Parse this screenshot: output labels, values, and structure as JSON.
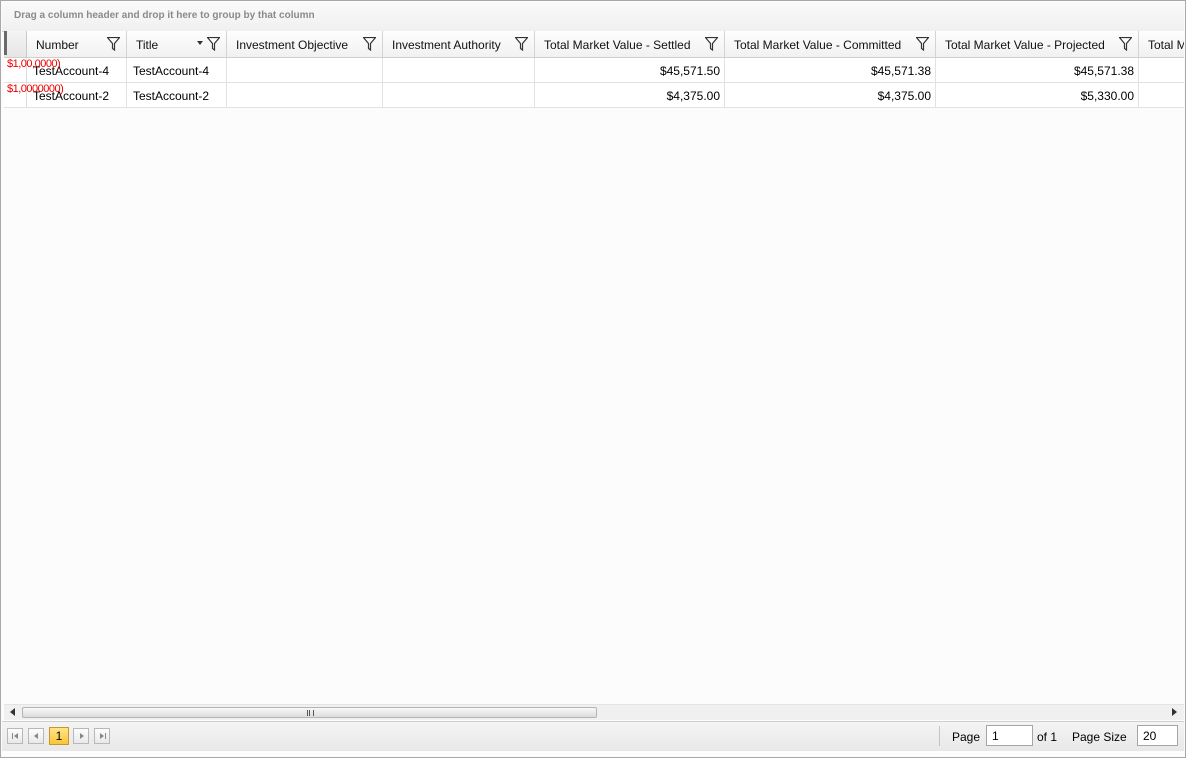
{
  "group_panel": {
    "hint": "Drag a column header and drop it here to group by that column"
  },
  "columns": [
    {
      "label": "Number"
    },
    {
      "label": "Title"
    },
    {
      "label": "Investment Objective"
    },
    {
      "label": "Investment Authority"
    },
    {
      "label": "Total Market Value - Settled"
    },
    {
      "label": "Total Market Value - Committed"
    },
    {
      "label": "Total Market Value - Projected"
    },
    {
      "label": "Total M"
    }
  ],
  "rows": [
    {
      "overlay": "$1,00,0000)",
      "number": "TestAccount-4",
      "title": "TestAccount-4",
      "objective": "",
      "authority": "",
      "settled": "$45,571.50",
      "committed": "$45,571.38",
      "projected": "$45,571.38"
    },
    {
      "overlay": "$1,0000000)",
      "number": "TestAccount-2",
      "title": "TestAccount-2",
      "objective": "",
      "authority": "",
      "settled": "$4,375.00",
      "committed": "$4,375.00",
      "projected": "$5,330.00"
    }
  ],
  "pager": {
    "current_page": "1",
    "page_label": "Page",
    "page_value": "1",
    "of_label": "of 1",
    "page_size_label": "Page Size",
    "page_size_value": "20"
  },
  "icons": [
    "filter-icon",
    "sort-desc-icon",
    "first-page-icon",
    "prev-page-icon",
    "next-page-icon",
    "last-page-icon",
    "scroll-left-icon",
    "scroll-right-icon"
  ]
}
